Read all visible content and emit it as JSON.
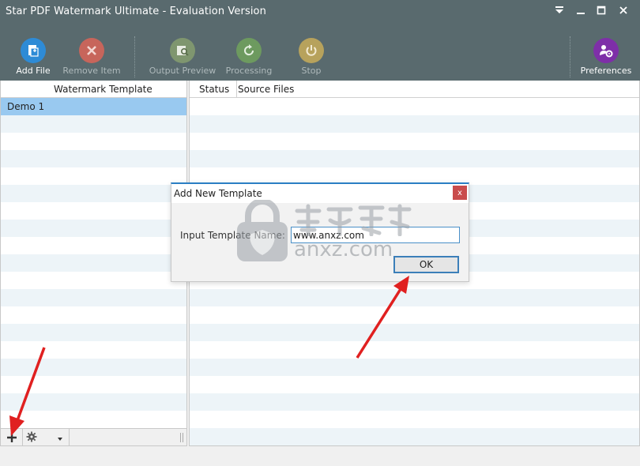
{
  "window": {
    "title": "Star PDF Watermark Ultimate - Evaluation Version"
  },
  "toolbar": {
    "add_file": "Add File",
    "remove_item": "Remove Item",
    "output_preview": "Output Preview",
    "processing": "Processing",
    "stop": "Stop",
    "preferences": "Preferences"
  },
  "left_panel": {
    "header": "Watermark Template",
    "items": [
      "Demo 1"
    ]
  },
  "right_panel": {
    "columns": [
      "Status",
      "Source Files"
    ]
  },
  "dialog": {
    "title": "Add New Template",
    "close_label": "x",
    "field_label": "Input Template Name:",
    "field_value": "www.anxz.com",
    "ok_label": "OK"
  },
  "watermark": {
    "text": "anxz.com"
  },
  "colors": {
    "toolbar_bg": "#596a6e",
    "selection": "#99c9f0",
    "row_alt": "#edf4f8",
    "close_red": "#c94c4c",
    "annotation_red": "#e02020"
  },
  "icons": {
    "add_file": "add-file-icon",
    "remove_item": "remove-x-icon",
    "output_preview": "preview-icon",
    "processing": "refresh-icon",
    "stop": "power-icon",
    "preferences": "users-gear-icon",
    "add_template": "plus-icon",
    "settings": "gear-icon",
    "dropdown": "chevron-down-icon"
  }
}
